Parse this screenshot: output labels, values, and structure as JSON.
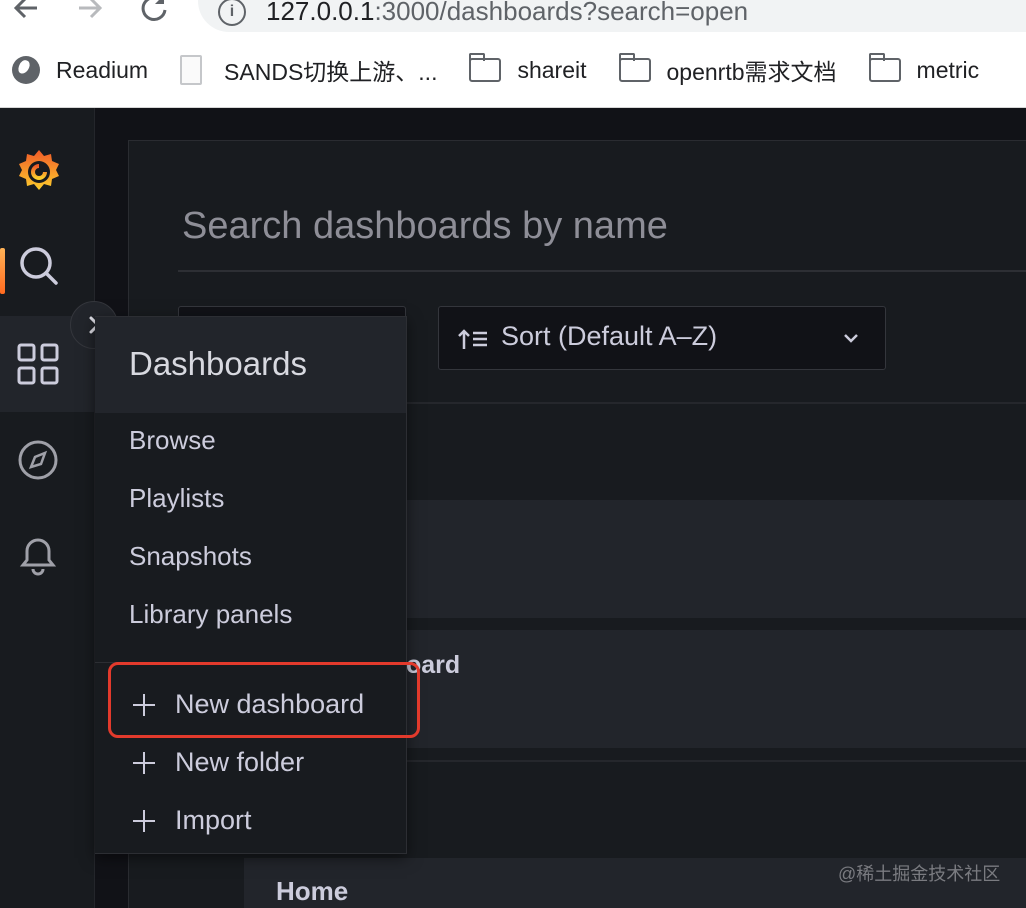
{
  "browser": {
    "url_host": "127.0.0.1",
    "url_rest": ":3000/dashboards?search=open",
    "bookmarks": [
      {
        "label": "Readium",
        "icon": "globe-icon"
      },
      {
        "label": "SANDS切换上游、...",
        "icon": "document-icon"
      },
      {
        "label": "shareit",
        "icon": "folder-icon"
      },
      {
        "label": "openrtb需求文档",
        "icon": "folder-icon"
      },
      {
        "label": "metric",
        "icon": "folder-icon"
      }
    ]
  },
  "sidemenu": {
    "items": [
      {
        "name": "search",
        "icon": "search-icon"
      },
      {
        "name": "dashboards",
        "icon": "apps-grid-icon"
      },
      {
        "name": "explore",
        "icon": "compass-icon"
      },
      {
        "name": "alerting",
        "icon": "bell-icon"
      }
    ]
  },
  "search": {
    "placeholder": "Search dashboards by name",
    "sort_label": "Sort (Default A–Z)"
  },
  "results": {
    "partial_title": "oard",
    "home_title": "Home"
  },
  "dropdown": {
    "title": "Dashboards",
    "links": [
      "Browse",
      "Playlists",
      "Snapshots",
      "Library panels"
    ],
    "actions": [
      "New dashboard",
      "New folder",
      "Import"
    ]
  },
  "watermark": "@稀土掘金技术社区",
  "colors": {
    "background": "#111217",
    "panel": "#181b1f",
    "accent": "#ff7f1f",
    "highlight_box": "#e23a2c"
  }
}
